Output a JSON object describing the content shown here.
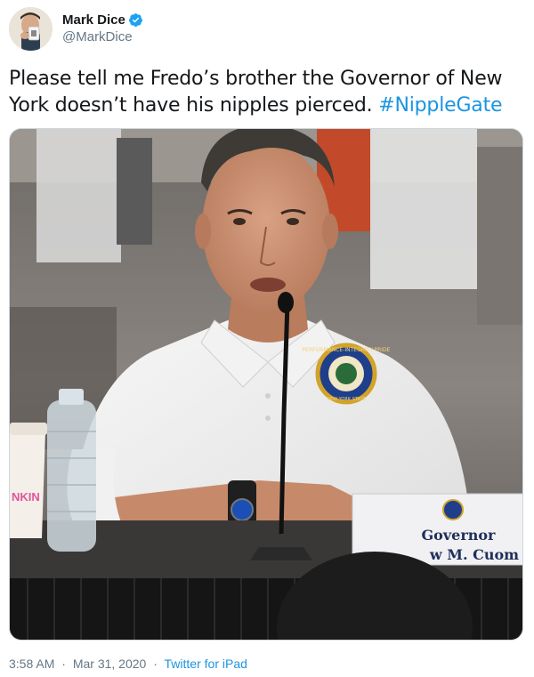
{
  "author": {
    "display_name": "Mark Dice",
    "handle": "@MarkDice",
    "verified": true
  },
  "tweet": {
    "text_main": "Please tell me Fredo’s brother the Governor of New York doesn’t have his nipples pierced. ",
    "hashtag": "#NippleGate"
  },
  "media": {
    "cup_brand": "NKIN",
    "nameplate_title": "Governor",
    "nameplate_name": "w M. Cuom",
    "patch_ring_text": "PERFORMANCE-INTEGRITY-PRIDE",
    "patch_bottom_text": "NEW YORK STATE"
  },
  "footer": {
    "time": "3:58 AM",
    "date": "Mar 31, 2020",
    "separator": "·",
    "source": "Twitter for iPad"
  },
  "colors": {
    "link": "#1b95e0",
    "secondary_text": "#657786",
    "verified_badge": "#1da1f2"
  }
}
